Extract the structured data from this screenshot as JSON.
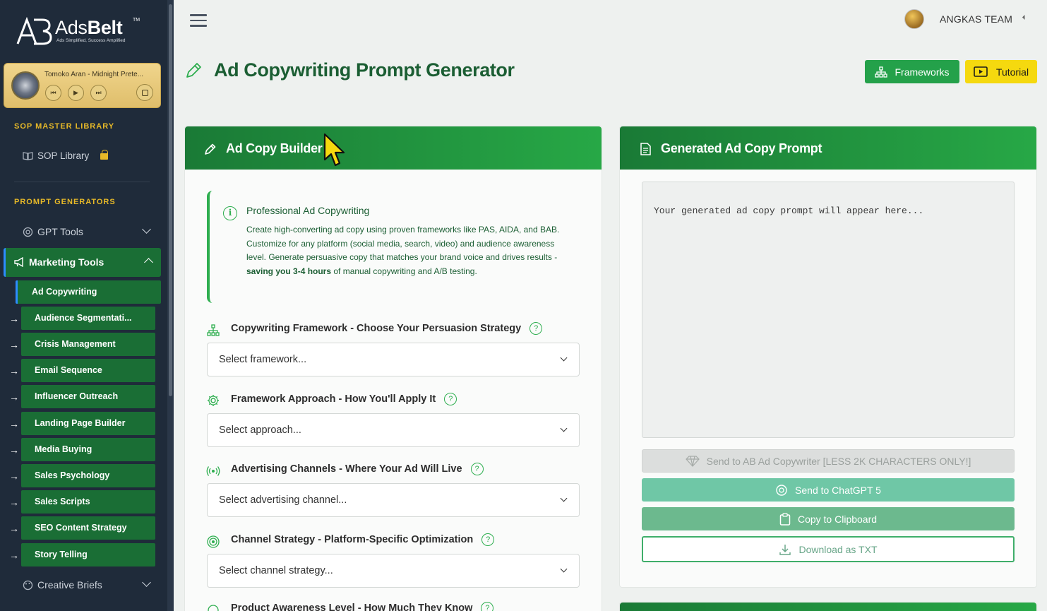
{
  "brand": {
    "name_light": "Ads",
    "name_bold": "Belt",
    "tm": "TM",
    "tagline": "Ads Simplified, Success Amplified"
  },
  "player": {
    "track": "Tomoko Aran - Midnight Prete...",
    "prev_icon": "⏮",
    "play_icon": "▶",
    "next_icon": "⏭"
  },
  "sidebar": {
    "section1": "SOP MASTER LIBRARY",
    "sop_library": "SOP Library",
    "section2": "PROMPT GENERATORS",
    "gpt_tools": "GPT Tools",
    "marketing_tools": "Marketing Tools",
    "active_sub": "Ad Copywriting",
    "sub_items": [
      "Audience Segmentati...",
      "Crisis Management",
      "Email Sequence",
      "Influencer Outreach",
      "Landing Page Builder",
      "Media Buying",
      "Sales Psychology",
      "Sales Scripts",
      "SEO Content Strategy",
      "Story Telling"
    ],
    "arrow_glyph": "→",
    "creative_briefs": "Creative Briefs"
  },
  "topbar": {
    "user": "ANGKAS TEAM"
  },
  "page": {
    "title": "Ad Copywriting Prompt Generator",
    "frameworks_btn": "Frameworks",
    "tutorial_btn": "Tutorial"
  },
  "builder": {
    "title": "Ad Copy Builder",
    "info_title": "Professional Ad Copywriting",
    "info_body_1": "Create high-converting ad copy using proven frameworks like PAS, AIDA, and BAB. Customize for any platform (social media, search, video) and audience awareness level. Generate persuasive copy that matches your brand voice and drives results - ",
    "info_body_bold": "saving you 3-4 hours",
    "info_body_2": " of manual copywriting and A/B testing.",
    "fields": [
      {
        "label": "Copywriting Framework - Choose Your Persuasion Strategy",
        "placeholder": "Select framework..."
      },
      {
        "label": "Framework Approach - How You'll Apply It",
        "placeholder": "Select approach..."
      },
      {
        "label": "Advertising Channels - Where Your Ad Will Live",
        "placeholder": "Select advertising channel..."
      },
      {
        "label": "Channel Strategy - Platform-Specific Optimization",
        "placeholder": "Select channel strategy..."
      },
      {
        "label": "Product Awareness Level - How Much They Know",
        "placeholder": ""
      }
    ]
  },
  "output": {
    "title": "Generated Ad Copy Prompt",
    "placeholder": "Your generated ad copy prompt will appear here...",
    "send_ab": "Send to AB Ad Copywriter [LESS 2K CHARACTERS ONLY!]",
    "send_gpt": "Send to ChatGPT 5",
    "copy": "Copy to Clipboard",
    "download": "Download as TXT"
  },
  "colors": {
    "sidebar_bg": "#1f2b3a",
    "accent_green": "#1a7a36",
    "gold": "#e7b928",
    "tutorial_yellow": "#f5d90f"
  }
}
